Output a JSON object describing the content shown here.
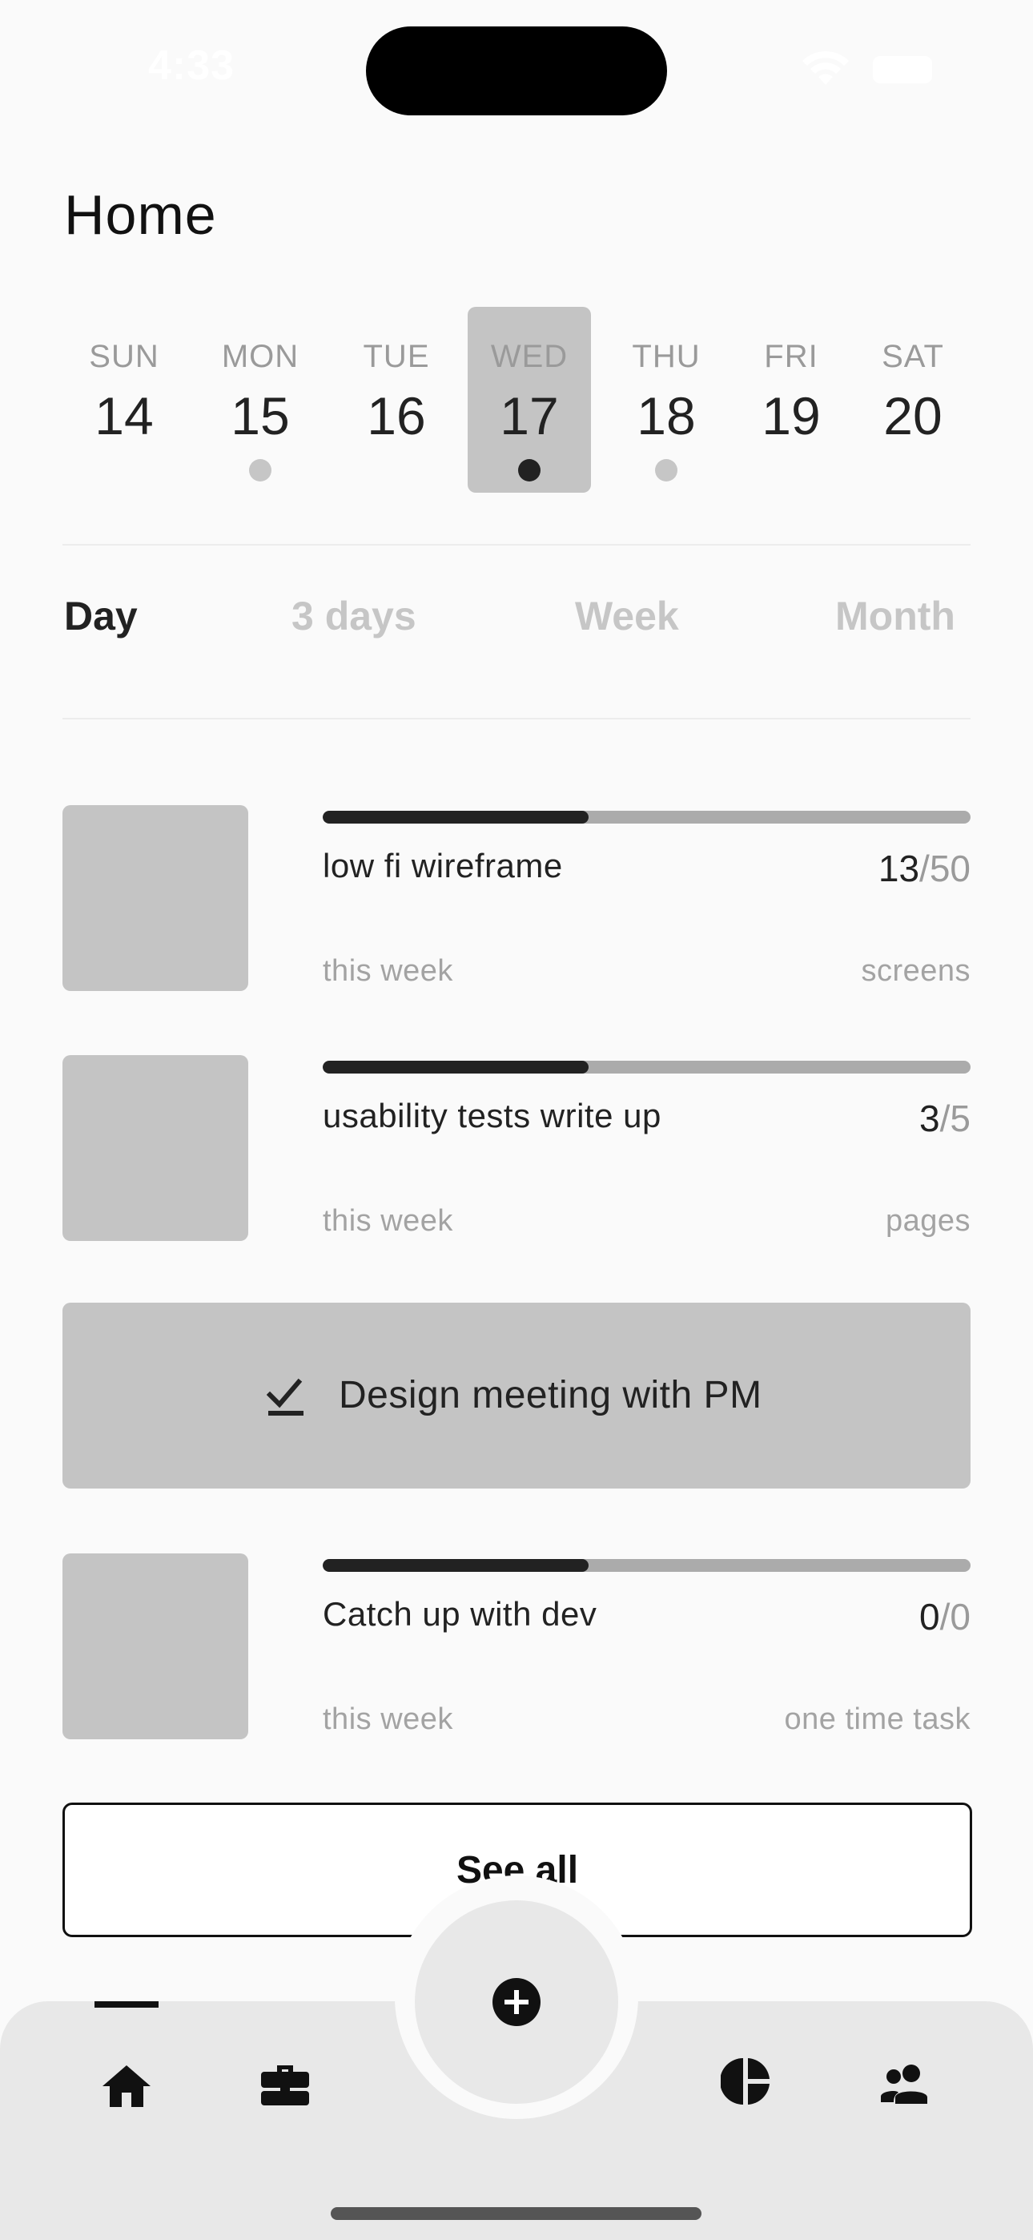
{
  "status_bar": {
    "time": "4:33"
  },
  "header": {
    "title": "Home"
  },
  "calendar": {
    "days": [
      {
        "name": "SUN",
        "date": "14",
        "has_event": false,
        "selected": false
      },
      {
        "name": "MON",
        "date": "15",
        "has_event": true,
        "selected": false
      },
      {
        "name": "TUE",
        "date": "16",
        "has_event": false,
        "selected": false
      },
      {
        "name": "WED",
        "date": "17",
        "has_event": true,
        "selected": true
      },
      {
        "name": "THU",
        "date": "18",
        "has_event": true,
        "selected": false
      },
      {
        "name": "FRI",
        "date": "19",
        "has_event": false,
        "selected": false
      },
      {
        "name": "SAT",
        "date": "20",
        "has_event": false,
        "selected": false
      }
    ]
  },
  "range_tabs": [
    {
      "label": "Day",
      "active": true
    },
    {
      "label": "3 days",
      "active": false
    },
    {
      "label": "Week",
      "active": false
    },
    {
      "label": "Month",
      "active": false
    }
  ],
  "tasks": [
    {
      "title": "low fi wireframe",
      "done": "13",
      "total": "/50",
      "period": "this week",
      "unit": "screens",
      "progress": 0.41
    },
    {
      "title": "usability tests write up",
      "done": "3",
      "total": "/5",
      "period": "this week",
      "unit": "pages",
      "progress": 0.41
    },
    {
      "title": "Catch up with dev",
      "done": "0",
      "total": "/0",
      "period": "this week",
      "unit": "one time task",
      "progress": 0.41
    }
  ],
  "meeting": {
    "label": "Design meeting with PM",
    "icon": "checkmark-icon"
  },
  "see_all": {
    "label": "See all"
  },
  "tab_bar": {
    "items": [
      {
        "name": "home-icon",
        "active": true
      },
      {
        "name": "briefcase-icon",
        "active": false
      },
      {
        "name": "pie-chart-icon",
        "active": false
      },
      {
        "name": "people-icon",
        "active": false
      }
    ],
    "fab_icon": "plus-circle-icon"
  },
  "colors": {
    "background": "#fafafa",
    "placeholder": "#c4c4c4",
    "accent": "#222222",
    "muted": "#9a9a9a"
  }
}
